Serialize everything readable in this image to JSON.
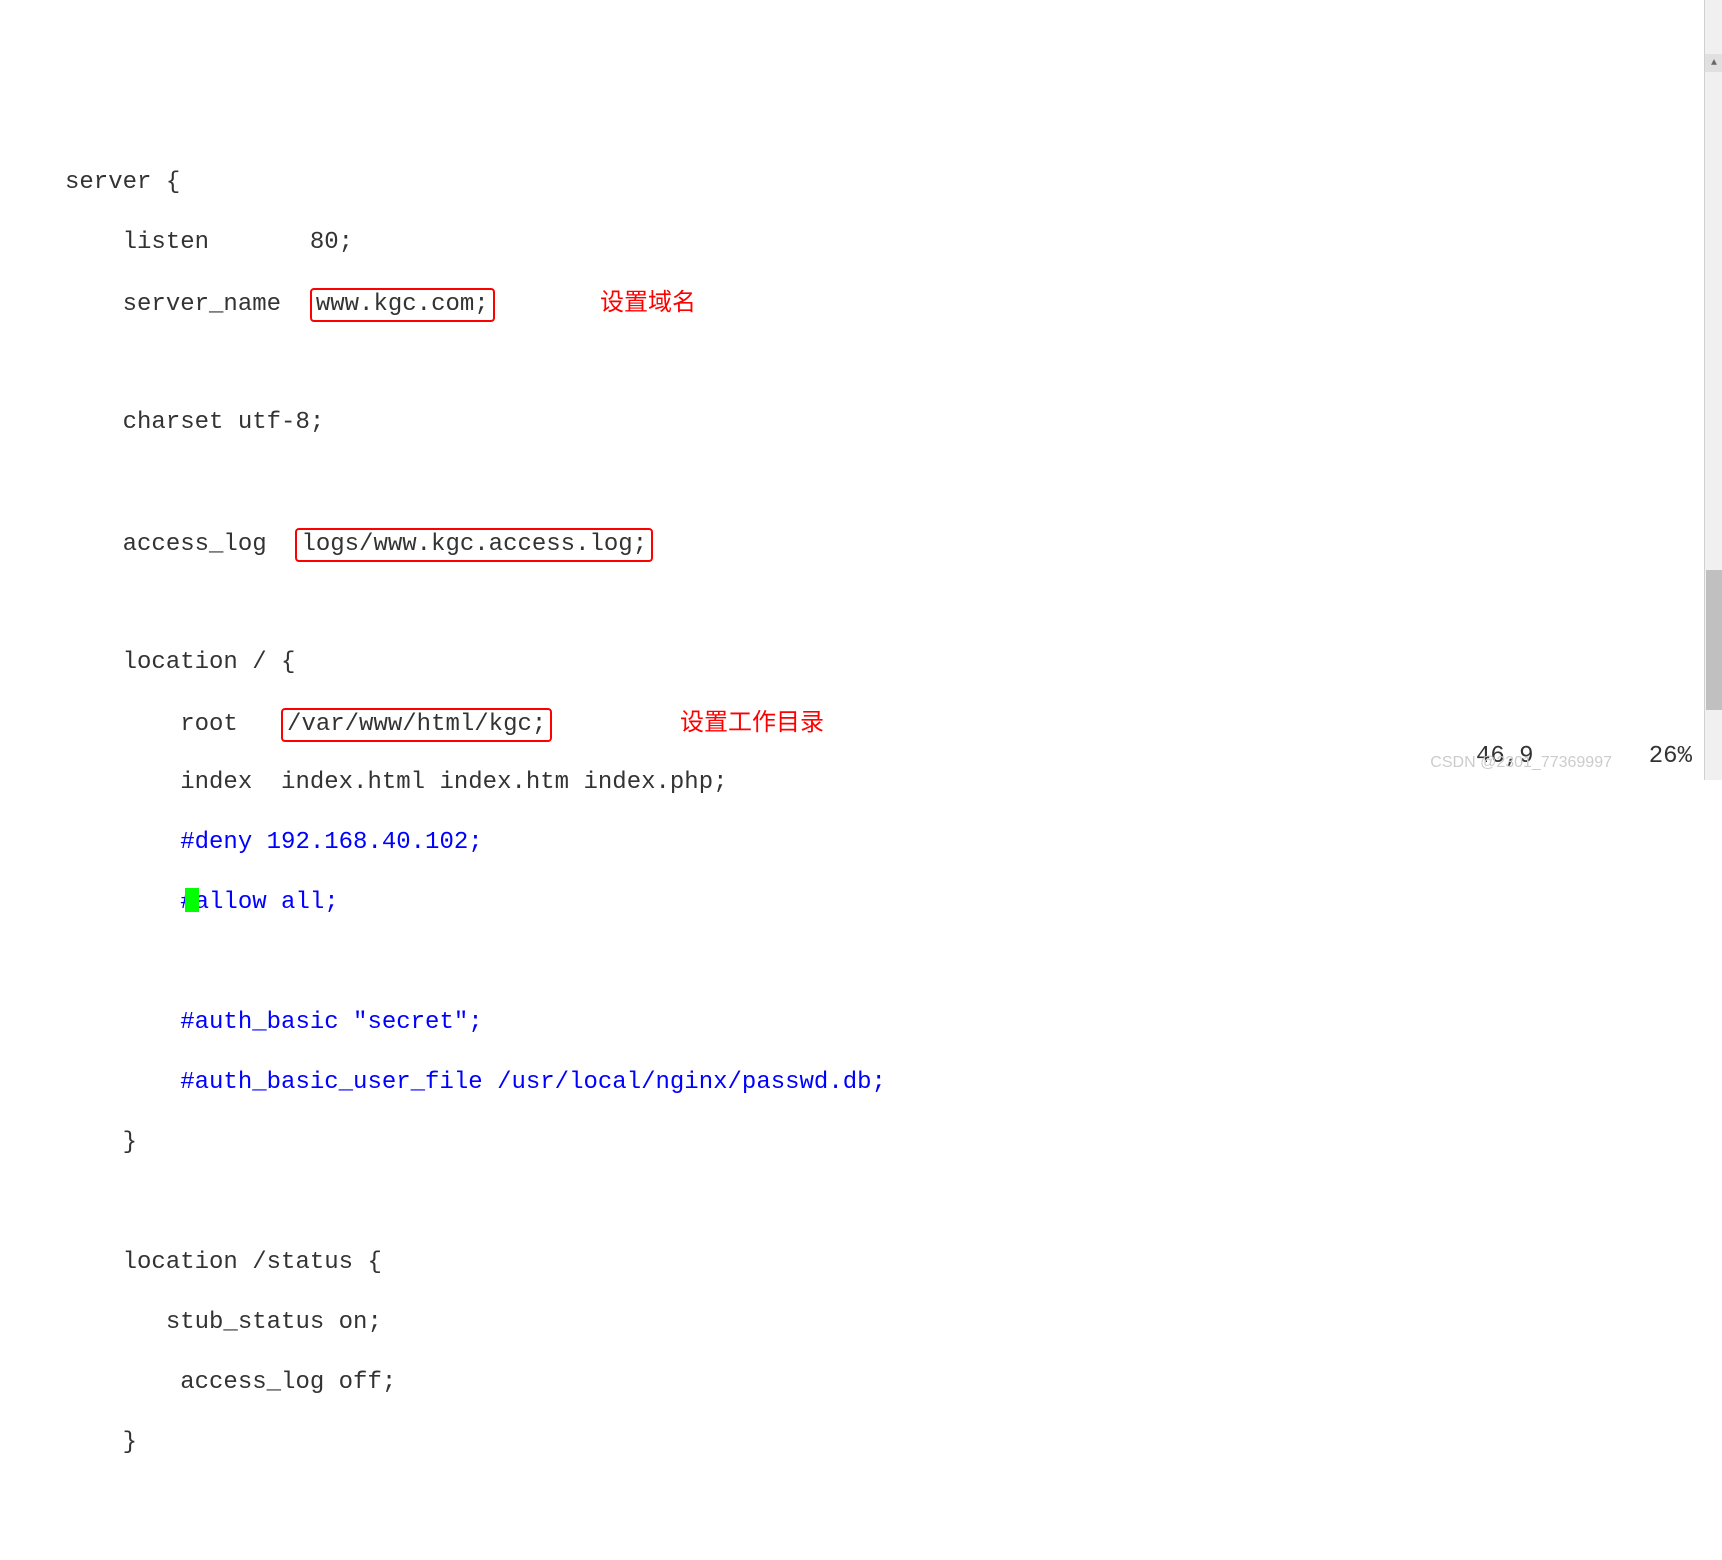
{
  "code": {
    "line1": "server {",
    "line2a": "    listen       80;",
    "line3a": "    server_name  ",
    "line3b": "www.kgc.com;",
    "line5": "    charset utf-8;",
    "line7a": "    access_log  ",
    "line7b": "logs/www.kgc.access.log;",
    "line9": "    location / {",
    "line10a": "        root   ",
    "line10b": "/var/www/html/kgc;",
    "line11": "        index  index.html index.htm index.php;",
    "line12": "        #deny 192.168.40.102;",
    "line13": "        #allow all;",
    "line15": "        #auth_basic \"secret\";",
    "line16": "        #auth_basic_user_file /usr/local/nginx/passwd.db;",
    "line17": "    }",
    "line19": "    location /status {",
    "line20": "       stub_status on;",
    "line21": "        access_log off;",
    "line22": "    }"
  },
  "annotations": {
    "domain": "设置域名",
    "workdir": "设置工作目录"
  },
  "status": {
    "position": "46,9",
    "percent": "26%"
  },
  "watermark": "CSDN @2301_77369997"
}
